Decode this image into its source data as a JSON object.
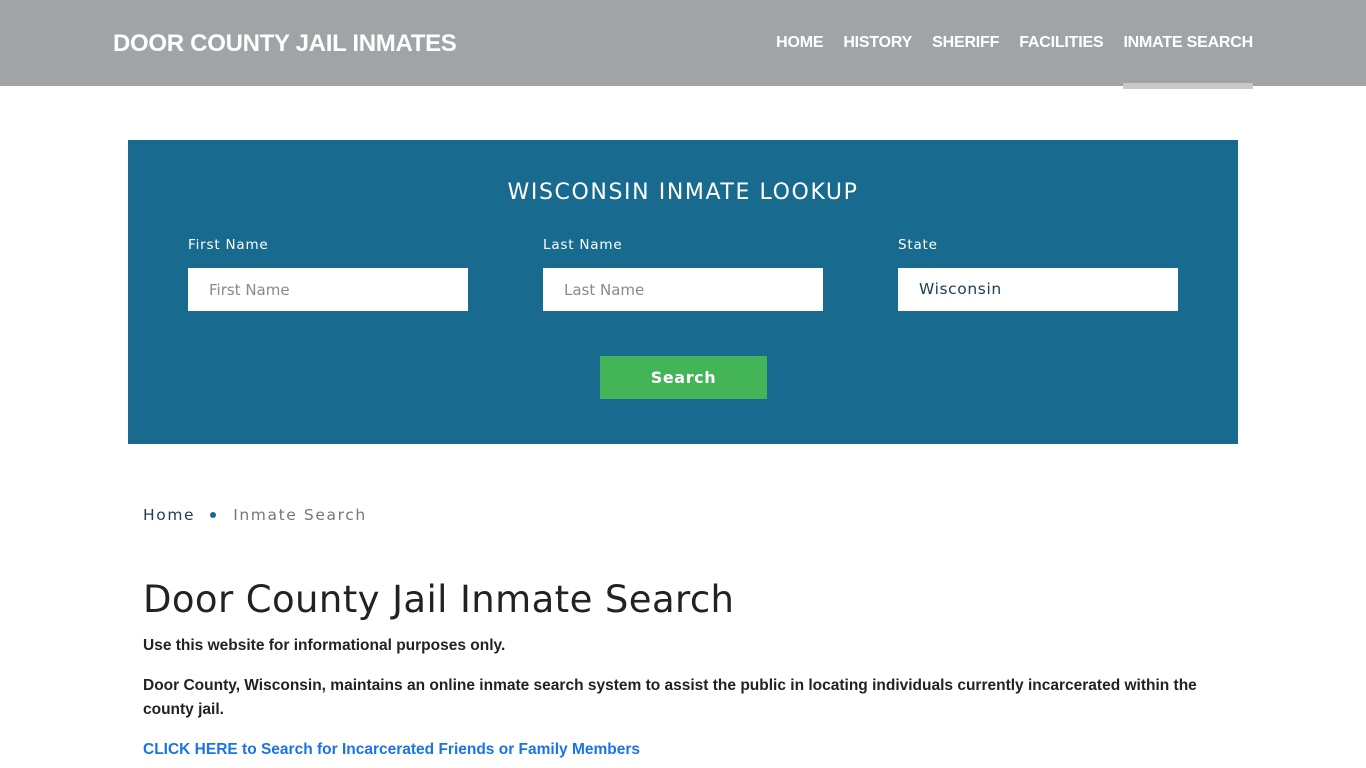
{
  "header": {
    "brand": "DOOR COUNTY JAIL INMATES",
    "nav": [
      {
        "label": "HOME",
        "active": false
      },
      {
        "label": "HISTORY",
        "active": false
      },
      {
        "label": "SHERIFF",
        "active": false
      },
      {
        "label": "FACILITIES",
        "active": false
      },
      {
        "label": "INMATE SEARCH",
        "active": true
      }
    ]
  },
  "lookup": {
    "title": "WISCONSIN INMATE LOOKUP",
    "first_name": {
      "label": "First Name",
      "placeholder": "First Name",
      "value": ""
    },
    "last_name": {
      "label": "Last Name",
      "placeholder": "Last Name",
      "value": ""
    },
    "state": {
      "label": "State",
      "value": "Wisconsin"
    },
    "search_label": "Search"
  },
  "breadcrumb": {
    "home": "Home",
    "current": "Inmate Search"
  },
  "content": {
    "title": "Door County Jail Inmate Search",
    "paragraph1": "Use this website for informational purposes only.",
    "paragraph2": "Door County, Wisconsin, maintains an online inmate search system to assist the public in locating individuals currently incarcerated within the county jail.",
    "cta": "CLICK HERE to Search for Incarcerated Friends or Family Members"
  },
  "colors": {
    "header_bg": "#a0a4a7",
    "lookup_bg": "#186b8e",
    "search_button": "#43b458",
    "link": "#1a73e8"
  }
}
